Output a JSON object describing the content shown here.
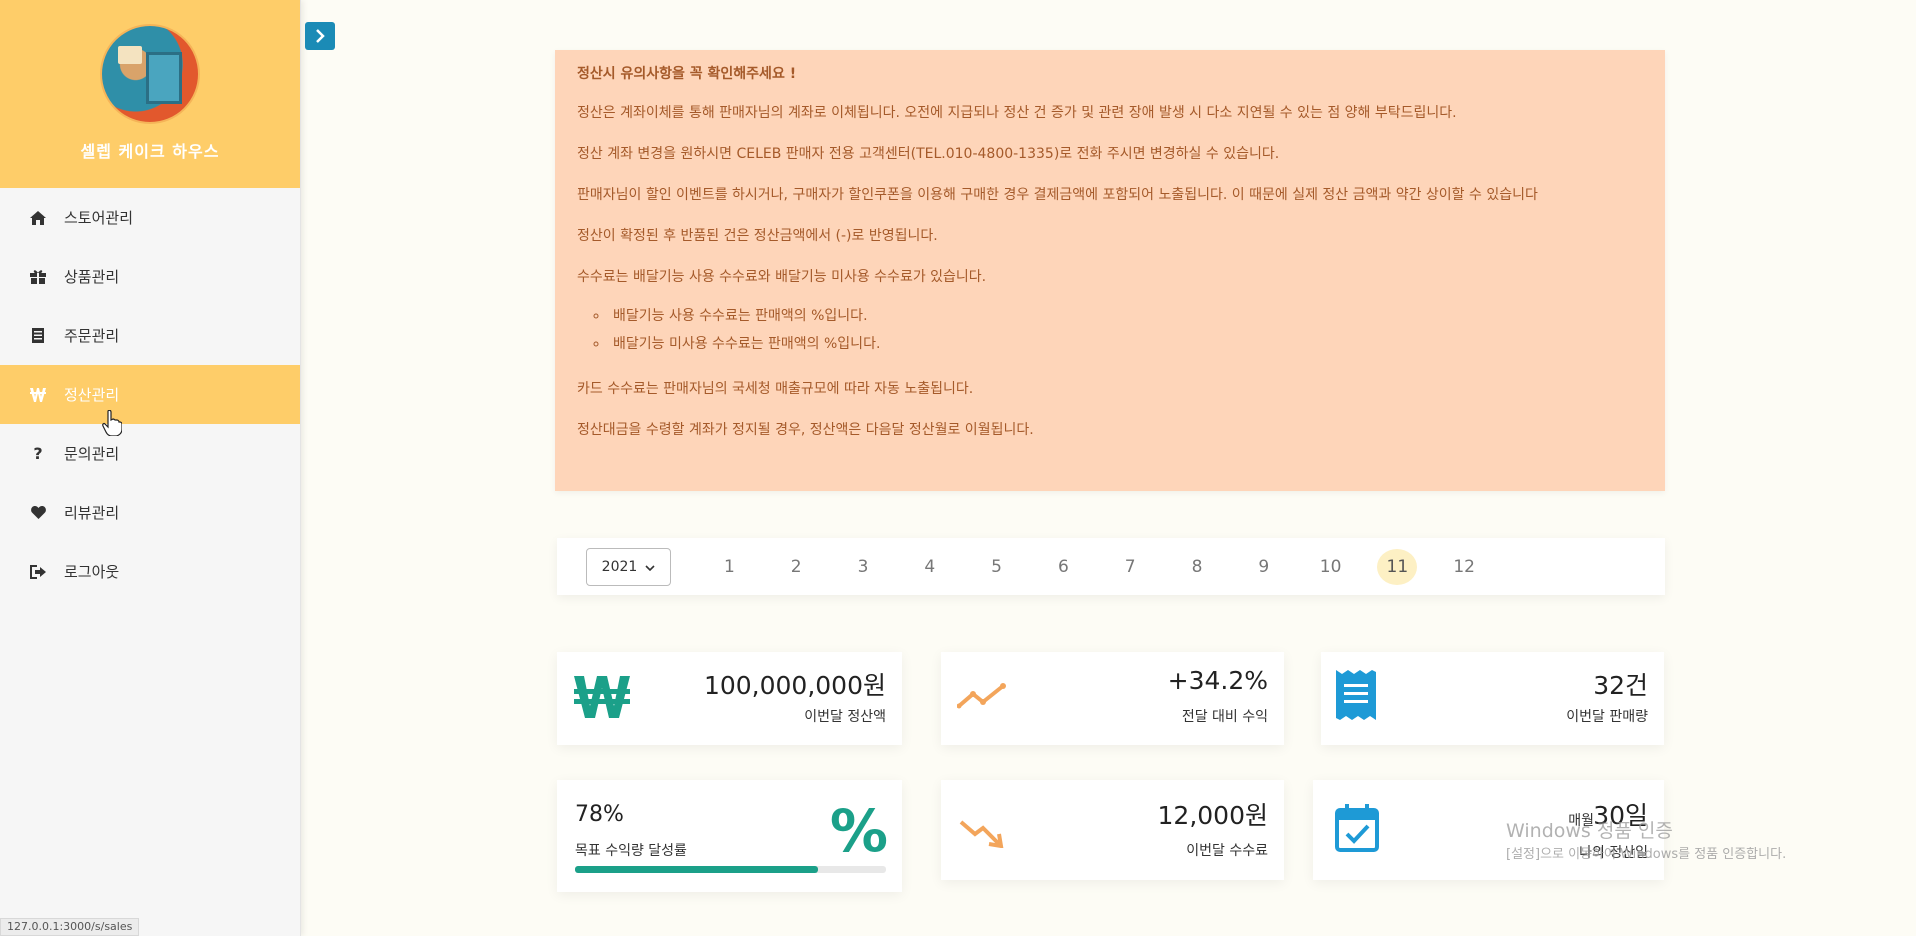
{
  "sidebar": {
    "store_name": "셀렙 케이크 하우스",
    "items": [
      {
        "label": "스토어관리",
        "icon": "home-icon"
      },
      {
        "label": "상품관리",
        "icon": "gift-icon"
      },
      {
        "label": "주문관리",
        "icon": "document-icon"
      },
      {
        "label": "정산관리",
        "icon": "won-icon",
        "active": true
      },
      {
        "label": "문의관리",
        "icon": "question-icon"
      },
      {
        "label": "리뷰관리",
        "icon": "heart-icon"
      },
      {
        "label": "로그아웃",
        "icon": "logout-icon"
      }
    ]
  },
  "status_url": "127.0.0.1:3000/s/sales",
  "notice": {
    "title": "정산시 유의사항을 꼭 확인해주세요 !",
    "lines": [
      "정산은 계좌이체를 통해 판매자님의 계좌로 이체됩니다. 오전에 지급되나 정산 건 증가 및 관련 장애 발생 시 다소 지연될 수 있는 점 양해 부탁드립니다.",
      "정산 계좌 변경을 원하시면 CELEB 판매자 전용 고객센터(TEL.010-4800-1335)로 전화 주시면 변경하실 수 있습니다.",
      "판매자님이 할인 이벤트를 하시거나, 구매자가 할인쿠폰을 이용해 구매한 경우 결제금액에 포함되어 노출됩니다. 이 때문에 실제 정산 금액과 약간 상이할 수 있습니다",
      "정산이 확정된 후 반품된 건은 정산금액에서 (-)로 반영됩니다.",
      "수수료는 배달기능 사용 수수료와 배달기능 미사용 수수료가 있습니다."
    ],
    "bullets": [
      "배달기능 사용 수수료는 판매액의 %입니다.",
      "배달기능 미사용 수수료는 판매액의 %입니다."
    ],
    "after": [
      "카드 수수료는 판매자님의 국세청 매출규모에 따라 자동 노출됩니다.",
      "정산대금을 수령할 계좌가 정지될 경우, 정산액은 다음달 정산월로 이월됩니다."
    ]
  },
  "period": {
    "year": "2021",
    "months": [
      "1",
      "2",
      "3",
      "4",
      "5",
      "6",
      "7",
      "8",
      "9",
      "10",
      "11",
      "12"
    ],
    "selected_month": "11"
  },
  "stats": {
    "settlement_amount": "100,000,000원",
    "settlement_label": "이번달 정산액",
    "growth_value": "+34.2%",
    "growth_label": "전달 대비 수익",
    "sales_count": "32건",
    "sales_label": "이번달 판매량",
    "goal_percent": "78%",
    "goal_label": "목표 수익량 달성률",
    "goal_progress": 0.78,
    "fee_amount": "12,000원",
    "fee_label": "이번달 수수료",
    "settle_day_prefix": "매월",
    "settle_day": "30일",
    "settle_day_label": "나의 정산일"
  },
  "watermark": {
    "line1": "Windows 정품 인증",
    "line2": "[설정]으로 이동하여 Windows를 정품 인증합니다."
  },
  "colors": {
    "accent": "#fecd69",
    "notice_bg": "#fed5b9",
    "won_green": "#1ba089",
    "blue_icon": "#1e9ad6",
    "orange_icon": "#f3a55b"
  }
}
